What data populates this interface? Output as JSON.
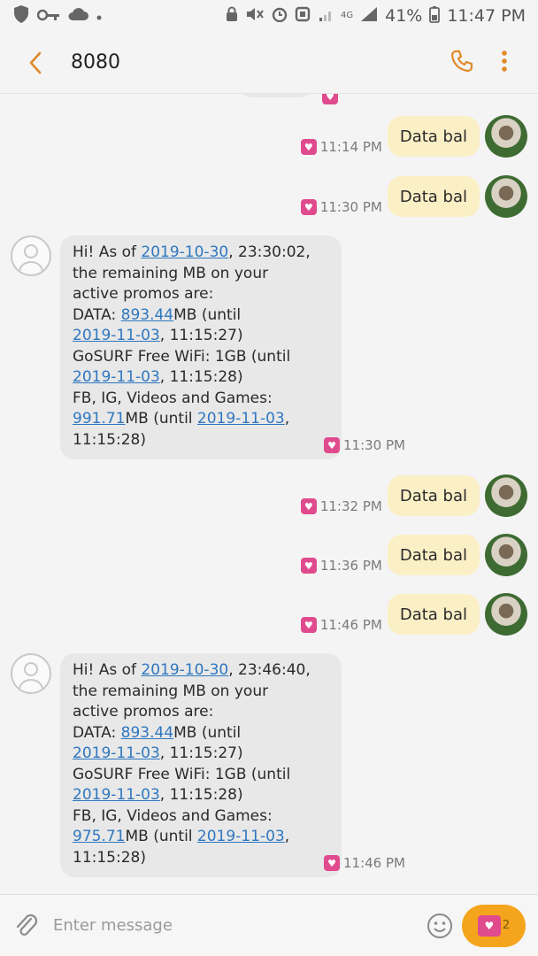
{
  "status": {
    "network": "4G",
    "battery": "41%",
    "time": "11:47 PM"
  },
  "header": {
    "title": "8080"
  },
  "messages": [
    {
      "type": "out",
      "text": "Data bal",
      "time": "11:14 PM"
    },
    {
      "type": "out",
      "text": "Data bal",
      "time": "11:30 PM"
    },
    {
      "type": "in",
      "line1_a": "Hi! As of ",
      "date1": "2019-10-30",
      "line1_b": ", 23:30:02,",
      "line2": "the remaining MB on your",
      "line3": "active promos are:",
      "l4_a": "DATA: ",
      "l4_num": "893.44",
      "l4_b": "MB (until",
      "l5_date": "2019-11-03",
      "l5_b": ", 11:15:27)",
      "l6": "GoSURF Free WiFi: 1GB (until",
      "l7_date": "2019-11-03",
      "l7_b": ", 11:15:28)",
      "l8": "FB, IG, Videos and Games:",
      "l9_num": "991.71",
      "l9_b": "MB (until ",
      "l9_date": "2019-11-03",
      "l9_c": ",",
      "l10": "11:15:28)",
      "time": "11:30 PM"
    },
    {
      "type": "out",
      "text": "Data bal",
      "time": "11:32 PM"
    },
    {
      "type": "out",
      "text": "Data bal",
      "time": "11:36 PM"
    },
    {
      "type": "out",
      "text": "Data bal",
      "time": "11:46 PM"
    },
    {
      "type": "in",
      "line1_a": "Hi! As of ",
      "date1": "2019-10-30",
      "line1_b": ", 23:46:40,",
      "line2": "the remaining MB on your",
      "line3": "active promos are:",
      "l4_a": "DATA: ",
      "l4_num": "893.44",
      "l4_b": "MB (until",
      "l5_date": "2019-11-03",
      "l5_b": ", 11:15:27)",
      "l6": "GoSURF Free WiFi: 1GB (until",
      "l7_date": "2019-11-03",
      "l7_b": ", 11:15:28)",
      "l8": "FB, IG, Videos and Games:",
      "l9_num": "975.71",
      "l9_b": "MB (until ",
      "l9_date": "2019-11-03",
      "l9_c": ",",
      "l10": "11:15:28)",
      "time": "11:46 PM"
    }
  ],
  "composer": {
    "placeholder": "Enter message",
    "send_count": "2"
  },
  "colors": {
    "accent": "#e0892a",
    "outgoing_bubble": "#fbefc6",
    "incoming_bubble": "#e8e8e8",
    "send_button": "#f4a51c",
    "link": "#2f77c0"
  }
}
